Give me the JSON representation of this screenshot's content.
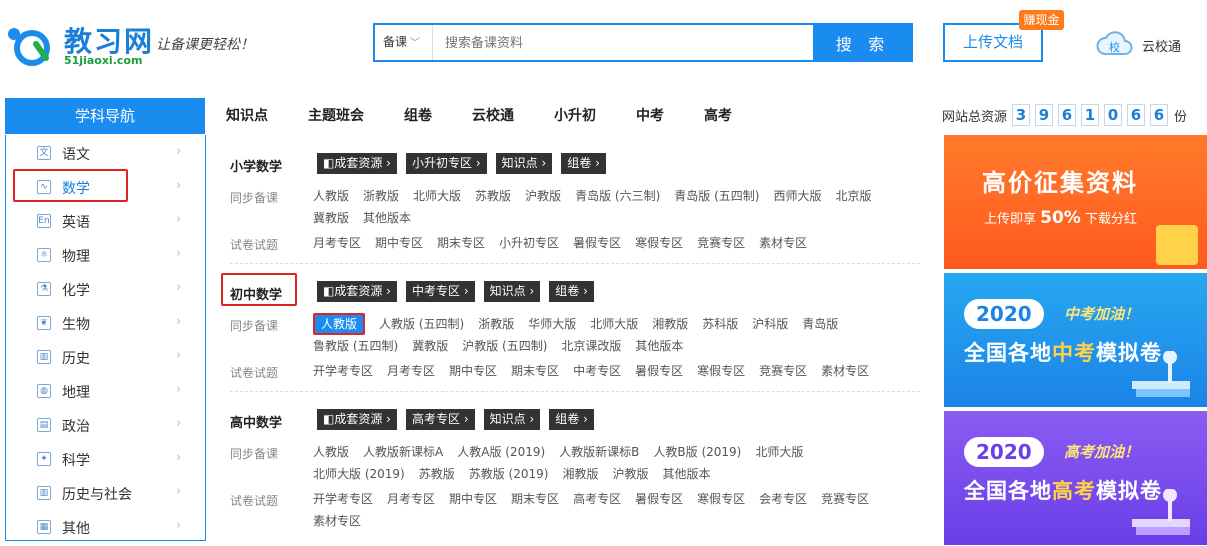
{
  "logo": {
    "name": "教习网",
    "domain": "51jiaoxi.com",
    "slogan": "让备课更轻松！"
  },
  "search": {
    "scope": "备课",
    "placeholder": "搜索备课资料",
    "button": "搜 索"
  },
  "header": {
    "upload": "上传文档",
    "earn_badge": "赚现金",
    "cloud": "云校通"
  },
  "nav": {
    "sidebar_title": "学科导航",
    "tabs": [
      "知识点",
      "主题班会",
      "组卷",
      "云校通",
      "小升初",
      "中考",
      "高考"
    ],
    "stats_label": "网站总资源",
    "stats_digits": [
      "3",
      "9",
      "6",
      "1",
      "0",
      "6",
      "6"
    ],
    "stats_unit": "份"
  },
  "subjects": [
    {
      "label": "语文",
      "icon": "book-icon",
      "glyph": "文"
    },
    {
      "label": "数学",
      "icon": "chart-icon",
      "glyph": "∿",
      "active": true
    },
    {
      "label": "英语",
      "icon": "english-icon",
      "glyph": "En"
    },
    {
      "label": "物理",
      "icon": "atom-icon",
      "glyph": "⚛"
    },
    {
      "label": "化学",
      "icon": "flask-icon",
      "glyph": "⚗"
    },
    {
      "label": "生物",
      "icon": "leaf-icon",
      "glyph": "❦"
    },
    {
      "label": "历史",
      "icon": "history-icon",
      "glyph": "▥"
    },
    {
      "label": "地理",
      "icon": "globe-icon",
      "glyph": "◍"
    },
    {
      "label": "政治",
      "icon": "politics-icon",
      "glyph": "▤"
    },
    {
      "label": "科学",
      "icon": "bulb-icon",
      "glyph": "✦"
    },
    {
      "label": "历史与社会",
      "icon": "society-icon",
      "glyph": "▥"
    },
    {
      "label": "其他",
      "icon": "grid-icon",
      "glyph": "▦"
    }
  ],
  "sections": [
    {
      "title": "小学数学",
      "chips": [
        "成套资源",
        "小升初专区",
        "知识点",
        "组卷"
      ],
      "sync_label": "同步备课",
      "sync": [
        "人教版",
        "浙教版",
        "北师大版",
        "苏教版",
        "沪教版",
        "青岛版 (六三制)",
        "青岛版 (五四制)",
        "西师大版",
        "北京版",
        "冀教版",
        "其他版本"
      ],
      "exam_label": "试卷试题",
      "exam": [
        "月考专区",
        "期中专区",
        "期末专区",
        "小升初专区",
        "暑假专区",
        "寒假专区",
        "竞赛专区",
        "素材专区"
      ]
    },
    {
      "title": "初中数学",
      "chips": [
        "成套资源",
        "中考专区",
        "知识点",
        "组卷"
      ],
      "sync_label": "同步备课",
      "sync": [
        "人教版",
        "人教版 (五四制)",
        "浙教版",
        "华师大版",
        "北师大版",
        "湘教版",
        "苏科版",
        "沪科版",
        "青岛版",
        "鲁教版 (五四制)",
        "冀教版",
        "沪教版 (五四制)",
        "北京课改版",
        "其他版本"
      ],
      "exam_label": "试卷试题",
      "exam": [
        "开学考专区",
        "月考专区",
        "期中专区",
        "期末专区",
        "中考专区",
        "暑假专区",
        "寒假专区",
        "竞赛专区",
        "素材专区"
      ]
    },
    {
      "title": "高中数学",
      "chips": [
        "成套资源",
        "高考专区",
        "知识点",
        "组卷"
      ],
      "sync_label": "同步备课",
      "sync": [
        "人教版",
        "人教版新课标A",
        "人教A版 (2019)",
        "人教版新课标B",
        "人教B版 (2019)",
        "北师大版",
        "北师大版 (2019)",
        "苏教版",
        "苏教版 (2019)",
        "湘教版",
        "沪教版",
        "其他版本"
      ],
      "exam_label": "试卷试题",
      "exam": [
        "开学考专区",
        "月考专区",
        "期中专区",
        "期末专区",
        "高考专区",
        "暑假专区",
        "寒假专区",
        "会考专区",
        "竞赛专区",
        "素材专区"
      ]
    }
  ],
  "banners": {
    "b1": {
      "title": "高价征集资料",
      "sub_a": "上传即享 ",
      "percent": "50%",
      "sub_b": " 下载分红"
    },
    "b2": {
      "year": "2020",
      "cheer": "中考加油！",
      "line_a": "全国各地",
      "line_y": "中考",
      "line_b": "模拟卷"
    },
    "b3": {
      "year": "2020",
      "cheer": "高考加油！",
      "line_a": "全国各地",
      "line_y": "高考",
      "line_b": "模拟卷"
    }
  },
  "colors": {
    "brand": "#1a8cf0",
    "highlight": "#e02323",
    "earn": "#ff7a1a"
  }
}
